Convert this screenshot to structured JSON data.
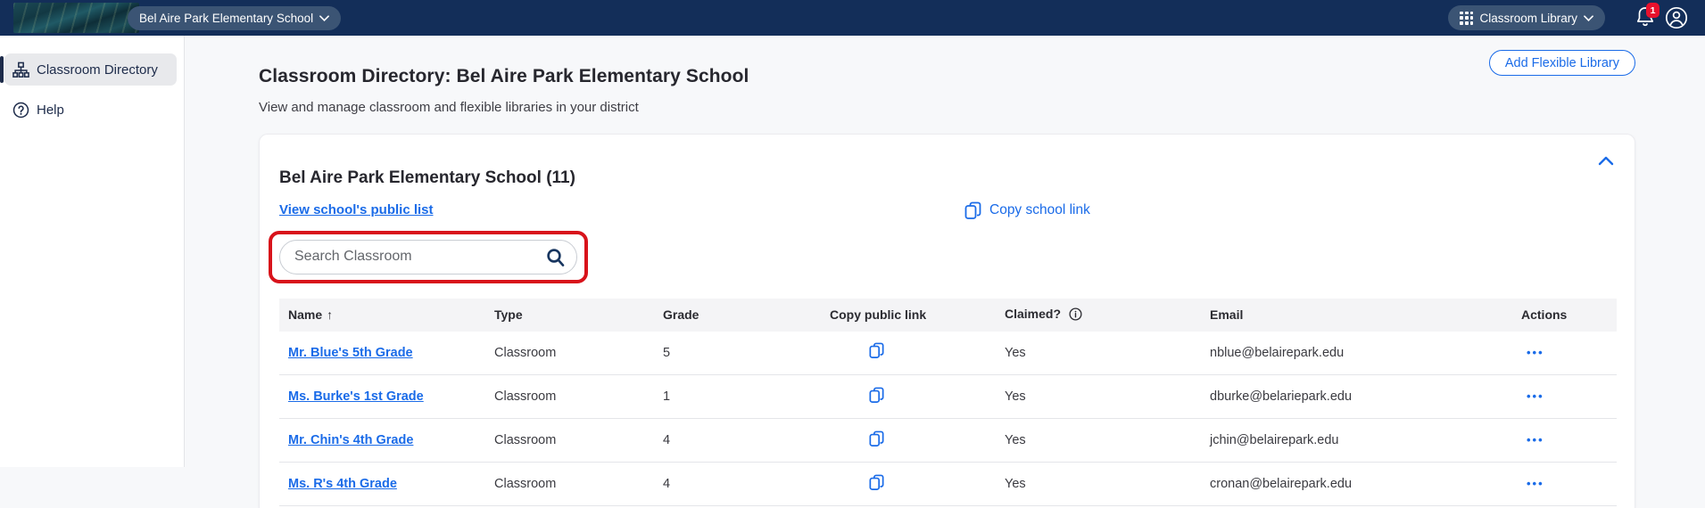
{
  "topnav": {
    "school_selector_label": "Bel Aire Park Elementary School",
    "app_switcher_label": "Classroom Library",
    "notification_badge": "1"
  },
  "sidebar": {
    "items": [
      {
        "label": "Classroom Directory",
        "selected": true
      },
      {
        "label": "Help",
        "selected": false
      }
    ]
  },
  "page": {
    "title": "Classroom Directory: Bel Aire Park Elementary School",
    "subtitle": "View and manage classroom and flexible libraries in your district",
    "add_flexible_library_button": "Add Flexible Library"
  },
  "school_card": {
    "title": "Bel Aire Park Elementary School (11)",
    "view_public_list_link": "View school's public list",
    "copy_school_link": "Copy school link",
    "search_placeholder": "Search Classroom"
  },
  "table": {
    "headers": {
      "name": "Name",
      "type": "Type",
      "grade": "Grade",
      "copy_public_link": "Copy public link",
      "claimed": "Claimed?",
      "email": "Email",
      "actions": "Actions"
    },
    "sort": {
      "column": "Name",
      "direction": "ascending",
      "indicator": "↑"
    },
    "actions_menu_glyph": "•••",
    "rows": [
      {
        "name": "Mr. Blue's 5th Grade",
        "type": "Classroom",
        "grade": "5",
        "claimed": "Yes",
        "email": "nblue@belairepark.edu"
      },
      {
        "name": "Ms. Burke's 1st Grade",
        "type": "Classroom",
        "grade": "1",
        "claimed": "Yes",
        "email": "dburke@belariepark.edu"
      },
      {
        "name": "Mr. Chin's 4th Grade",
        "type": "Classroom",
        "grade": "4",
        "claimed": "Yes",
        "email": "jchin@belairepark.edu"
      },
      {
        "name": "Ms. R's 4th Grade",
        "type": "Classroom",
        "grade": "4",
        "claimed": "Yes",
        "email": "cronan@belairepark.edu"
      }
    ]
  },
  "colors": {
    "nav_bg": "#132e59",
    "accent_blue": "#1a6be8",
    "annotation_red": "#d8131b",
    "badge_red": "#e8112d"
  }
}
